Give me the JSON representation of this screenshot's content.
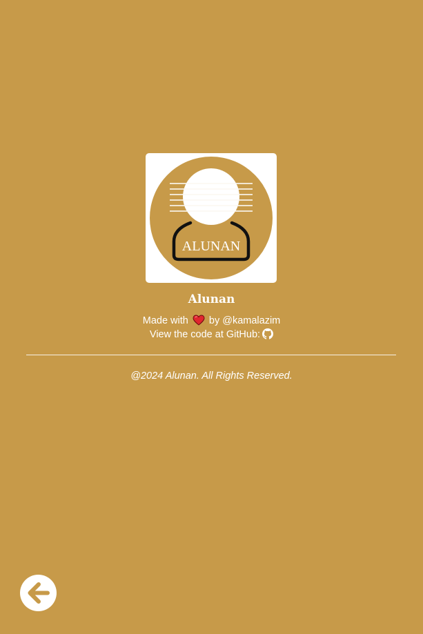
{
  "logo": {
    "icon": "alunan-logo-icon",
    "text": "ALUNAN"
  },
  "app": {
    "name": "Alunan"
  },
  "footer": {
    "made_with_prefix": "Made with",
    "made_with_icon": "heart-icon",
    "made_with_suffix": "by @kamalazim",
    "code_text": "View the code at GitHub:",
    "code_icon": "github-icon",
    "copyright": "@2024 Alunan. All Rights Reserved."
  },
  "nav": {
    "back_icon": "arrow-left-icon"
  },
  "colors": {
    "background": "#c79a49",
    "card": "#ffffff",
    "heart": "#e0262e"
  }
}
